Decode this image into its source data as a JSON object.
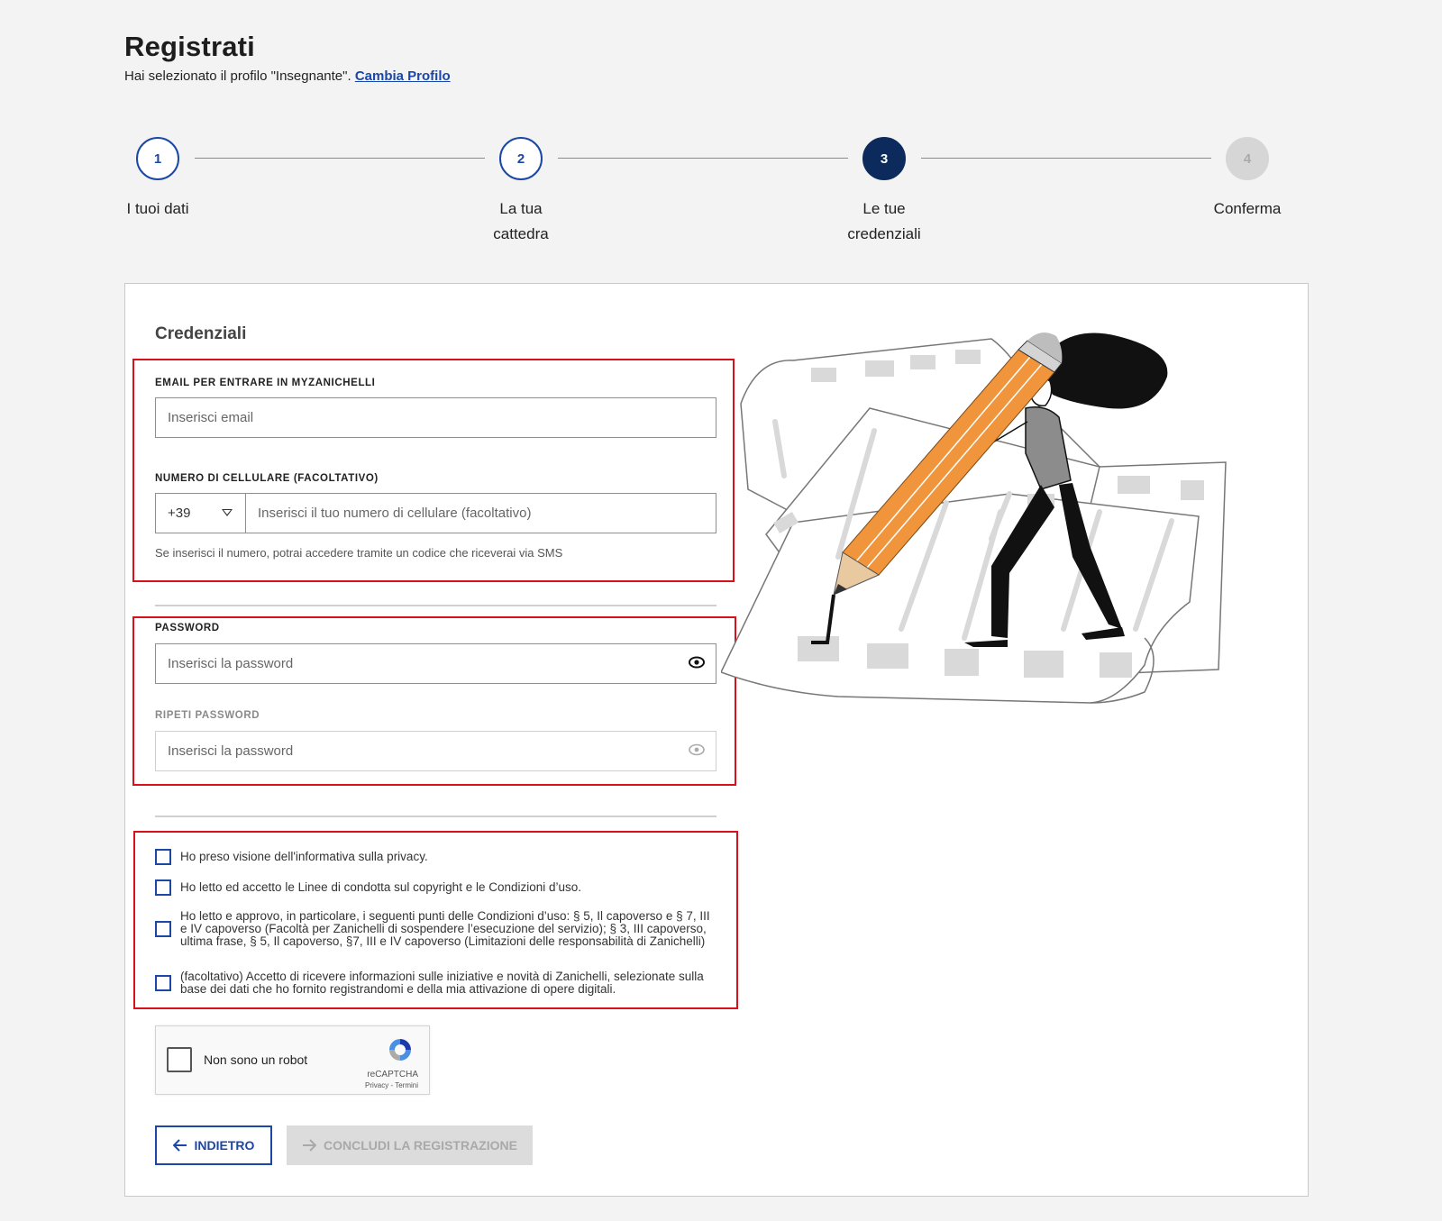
{
  "header": {
    "title": "Registrati",
    "subtitle": "Hai selezionato il profilo \"Insegnante\".",
    "change_profile_link": "Cambia Profilo"
  },
  "stepper": {
    "steps": [
      {
        "number": "1",
        "label_line1": "I tuoi dati",
        "label_line2": ""
      },
      {
        "number": "2",
        "label_line1": "La tua",
        "label_line2": "cattedra"
      },
      {
        "number": "3",
        "label_line1": "Le tue",
        "label_line2": "credenziali"
      },
      {
        "number": "4",
        "label_line1": "Conferma",
        "label_line2": ""
      }
    ],
    "active_step": 3
  },
  "form": {
    "section_title": "Credenziali",
    "email": {
      "label": "EMAIL PER ENTRARE IN MYZANICHELLI",
      "placeholder": "Inserisci email"
    },
    "phone": {
      "label": "NUMERO DI CELLULARE (FACOLTATIVO)",
      "prefix": "+39",
      "placeholder": "Inserisci il tuo numero di cellulare (facoltativo)",
      "help": "Se inserisci il numero, potrai accedere tramite un codice che riceverai via SMS"
    },
    "password": {
      "label": "PASSWORD",
      "placeholder": "Inserisci la password"
    },
    "repeat_password": {
      "label": "RIPETI PASSWORD",
      "placeholder": "Inserisci la password"
    },
    "checkboxes": [
      "Ho preso visione dell'informativa sulla privacy.",
      "Ho letto ed accetto le Linee di condotta sul copyright e le Condizioni d’uso.",
      "Ho letto e approvo, in particolare, i seguenti punti delle Condizioni d’uso: § 5, Il capoverso e § 7, III e IV capoverso (Facoltà per Zanichelli di sospendere l’esecuzione del servizio); § 3, III capoverso, ultima frase, § 5, Il capoverso, §7, III e IV capoverso (Limitazioni delle responsabilità di Zanichelli)",
      "(facoltativo) Accetto di ricevere informazioni sulle iniziative e novità di Zanichelli, selezionate sulla base dei dati che ho fornito registrandomi e della mia attivazione di opere digitali."
    ],
    "recaptcha": {
      "label": "Non sono un robot",
      "brand": "reCAPTCHA",
      "links": "Privacy - Termini"
    },
    "buttons": {
      "back": "INDIETRO",
      "submit": "CONCLUDI LA REGISTRAZIONE"
    }
  },
  "colors": {
    "accent": "#1b47a6",
    "active_step": "#0c2a5c",
    "highlight": "#d8101a",
    "pencil": "#f0953c"
  }
}
